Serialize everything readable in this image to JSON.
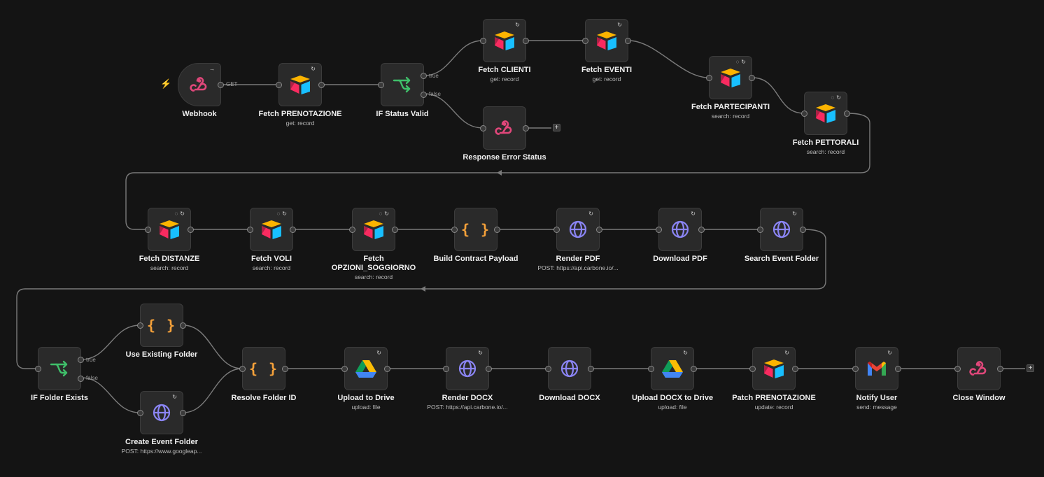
{
  "colors": {
    "background": "#141414",
    "node": "#2a2a2a",
    "wire": "#7a7a7a"
  },
  "trigger_method": "GET",
  "branch_labels": {
    "true": "true",
    "false": "false"
  },
  "add_label": "+",
  "nodes": [
    {
      "key": "webhook",
      "icon": "webhook-icon",
      "title": "Webhook",
      "subtitle": ""
    },
    {
      "key": "fetch_prenotazione",
      "icon": "airtable-icon",
      "title": "Fetch PRENOTAZIONE",
      "subtitle": "get: record"
    },
    {
      "key": "if_status",
      "icon": "if-icon",
      "title": "IF Status Valid",
      "subtitle": ""
    },
    {
      "key": "fetch_clienti",
      "icon": "airtable-icon",
      "title": "Fetch CLIENTI",
      "subtitle": "get: record"
    },
    {
      "key": "fetch_eventi",
      "icon": "airtable-icon",
      "title": "Fetch EVENTI",
      "subtitle": "get: record"
    },
    {
      "key": "fetch_partecipanti",
      "icon": "airtable-icon",
      "title": "Fetch PARTECIPANTI",
      "subtitle": "search: record"
    },
    {
      "key": "fetch_pettorali",
      "icon": "airtable-icon",
      "title": "Fetch PETTORALI",
      "subtitle": "search: record"
    },
    {
      "key": "response_error",
      "icon": "webhook-icon",
      "title": "Response Error Status",
      "subtitle": ""
    },
    {
      "key": "fetch_distanze",
      "icon": "airtable-icon",
      "title": "Fetch DISTANZE",
      "subtitle": "search: record"
    },
    {
      "key": "fetch_voli",
      "icon": "airtable-icon",
      "title": "Fetch VOLI",
      "subtitle": "search: record"
    },
    {
      "key": "fetch_opzioni",
      "icon": "airtable-icon",
      "title": "Fetch\nOPZIONI_SOGGIORNO",
      "subtitle": "search: record"
    },
    {
      "key": "build_contract",
      "icon": "code-icon",
      "title": "Build Contract Payload",
      "subtitle": ""
    },
    {
      "key": "render_pdf",
      "icon": "globe-icon",
      "title": "Render PDF",
      "subtitle": "POST: https://api.carbone.io/..."
    },
    {
      "key": "download_pdf",
      "icon": "globe-icon",
      "title": "Download PDF",
      "subtitle": ""
    },
    {
      "key": "search_event_folder",
      "icon": "globe-icon",
      "title": "Search Event Folder",
      "subtitle": ""
    },
    {
      "key": "if_folder",
      "icon": "if-icon",
      "title": "IF Folder Exists",
      "subtitle": ""
    },
    {
      "key": "use_existing",
      "icon": "code-icon",
      "title": "Use Existing Folder",
      "subtitle": ""
    },
    {
      "key": "create_event_folder",
      "icon": "globe-icon",
      "title": "Create Event Folder",
      "subtitle": "POST: https://www.googleap..."
    },
    {
      "key": "resolve_folder",
      "icon": "code-icon",
      "title": "Resolve Folder ID",
      "subtitle": ""
    },
    {
      "key": "upload_drive",
      "icon": "drive-icon",
      "title": "Upload to Drive",
      "subtitle": "upload: file"
    },
    {
      "key": "render_docx",
      "icon": "globe-icon",
      "title": "Render DOCX",
      "subtitle": "POST: https://api.carbone.io/..."
    },
    {
      "key": "download_docx",
      "icon": "globe-icon",
      "title": "Download DOCX",
      "subtitle": ""
    },
    {
      "key": "upload_docx_drive",
      "icon": "drive-icon",
      "title": "Upload DOCX to Drive",
      "subtitle": "upload: file"
    },
    {
      "key": "patch_prenotazione",
      "icon": "airtable-icon",
      "title": "Patch PRENOTAZIONE",
      "subtitle": "update: record"
    },
    {
      "key": "notify_user",
      "icon": "gmail-icon",
      "title": "Notify User",
      "subtitle": "send: message"
    },
    {
      "key": "close_window",
      "icon": "webhook-icon",
      "title": "Close Window",
      "subtitle": ""
    }
  ]
}
